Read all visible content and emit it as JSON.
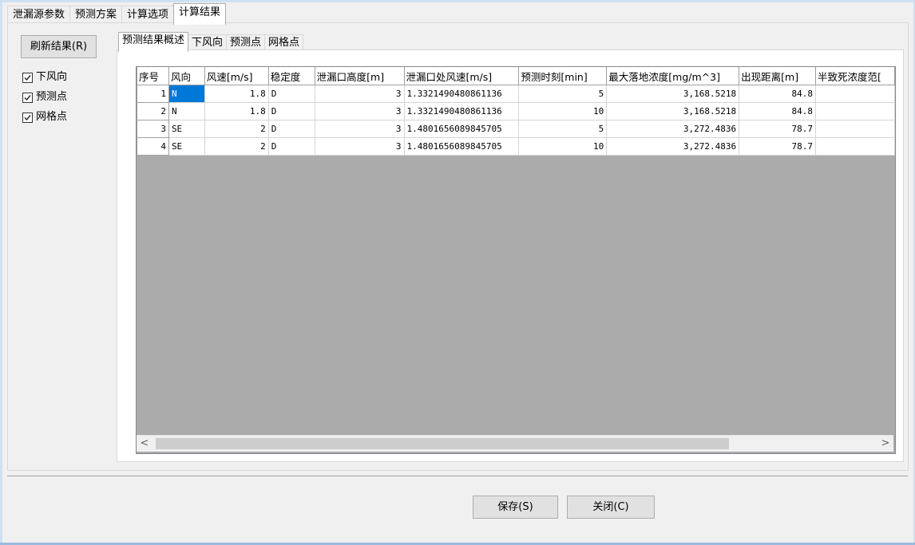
{
  "outer_tabs": [
    "泄漏源参数",
    "预测方案",
    "计算选项",
    "计算结果"
  ],
  "refresh_label": "刷新结果(R)",
  "checks": [
    "下风向",
    "预测点",
    "网格点"
  ],
  "inner_tabs": [
    "预测结果概述",
    "下风向",
    "预测点",
    "网格点"
  ],
  "table": {
    "headers": [
      "序号",
      "风向",
      "风速[m/s]",
      "稳定度",
      "泄漏口高度[m]",
      "泄漏口处风速[m/s]",
      "预测时刻[min]",
      "最大落地浓度[mg/m^3]",
      "出现距离[m]",
      "半致死浓度范["
    ],
    "rows": [
      [
        "1",
        "N",
        "1.8",
        "D",
        "3",
        "1.3321490480861136",
        "5",
        "3,168.5218",
        "84.8",
        ""
      ],
      [
        "2",
        "N",
        "1.8",
        "D",
        "3",
        "1.3321490480861136",
        "10",
        "3,168.5218",
        "84.8",
        ""
      ],
      [
        "3",
        "SE",
        "2",
        "D",
        "3",
        "1.4801656089845705",
        "5",
        "3,272.4836",
        "78.7",
        ""
      ],
      [
        "4",
        "SE",
        "2",
        "D",
        "3",
        "1.4801656089845705",
        "10",
        "3,272.4836",
        "78.7",
        ""
      ]
    ]
  },
  "buttons": {
    "save": "保存(S)",
    "close": "关闭(C)"
  },
  "scroll_left": "<",
  "scroll_right": ">"
}
